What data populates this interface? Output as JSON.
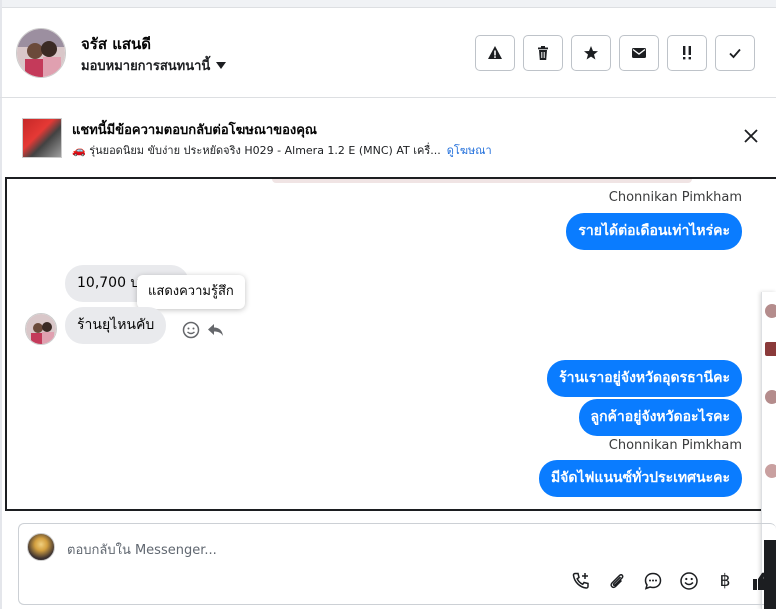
{
  "contact": {
    "name": "จรัส แสนดี",
    "assign_label": "มอบหมายการสนทนานี้"
  },
  "header_actions": [
    {
      "name": "report-spam-button",
      "icon": "warning-icon"
    },
    {
      "name": "delete-button",
      "icon": "trash-icon"
    },
    {
      "name": "star-button",
      "icon": "star-icon"
    },
    {
      "name": "mark-unread-button",
      "icon": "envelope-icon"
    },
    {
      "name": "follow-up-button",
      "icon": "exclamation-icon"
    },
    {
      "name": "mark-done-button",
      "icon": "check-icon"
    }
  ],
  "ad": {
    "title": "แชทนี้มีข้อความตอบกลับต่อโฆษณาของคุณ",
    "subtitle": "🚗 รุ่นยอดนิยม ขับง่าย ประหยัดจริง H029 - Almera 1.2 E (MNC) AT เครื่...",
    "link": "ดูโฆษณา"
  },
  "messages": {
    "sender_1": "Chonnikan Pimkham",
    "out_1": "รายได้ต่อเดือนเท่าไหร่คะ",
    "in_1": "10,700 บาท",
    "in_2": "ร้านยุไหนคับ",
    "tooltip": "แสดงความรู้สึก",
    "out_2": "ร้านเราอยู่จังหวัดอุดรธานีคะ",
    "out_3": "ลูกค้าอยู่จังหวัดอะไรคะ",
    "sender_2": "Chonnikan Pimkham",
    "out_4": "มีจัดไฟแนนซ์ทั่วประเทศนะคะ"
  },
  "composer": {
    "placeholder": "ตอบกลับใน Messenger...",
    "tools": [
      "phone-plus-icon",
      "paperclip-icon",
      "chat-bubble-icon",
      "smiley-icon",
      "baht-icon",
      "thumbs-up-icon"
    ],
    "baht_symbol": "฿"
  },
  "colors": {
    "outgoing_bubble": "#0a7cff",
    "incoming_bubble": "#e9eaed",
    "link": "#216fdb"
  }
}
